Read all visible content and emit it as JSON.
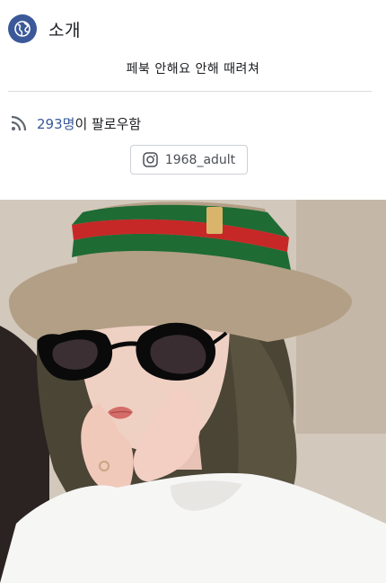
{
  "intro": {
    "title": "소개",
    "icon": "globe-icon",
    "bio": "페북 안해요 안해 때려쳐"
  },
  "followers": {
    "icon": "rss-icon",
    "count": "293명",
    "suffix": "이 팔로우함"
  },
  "instagram": {
    "icon": "instagram-icon",
    "handle": "1968_adult"
  },
  "photo": {
    "subject": "selfie-photo"
  },
  "colors": {
    "accent": "#3b5998",
    "link": "#385898",
    "text": "#1c1e21",
    "muted": "#606770",
    "border": "#ccd0d5",
    "divider": "#dadde1"
  }
}
